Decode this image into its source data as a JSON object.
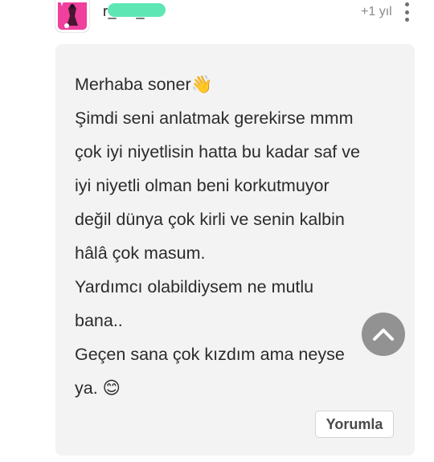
{
  "comment": {
    "username": "r_kie_",
    "time": "+1 yıl",
    "text": "Merhaba soner👋\nŞimdi seni anlatmak gerekirse mmm\nçok iyi niyetlisin hatta bu kadar saf ve\niyi niyetli olman beni korkutmuyor\ndeğil dünya çok kirli ve senin kalbin\nhâlâ çok masum.\nYardımcı olabildiysem ne mutlu\nbana..\nGeçen sana çok kızdım ama neyse\nya. 😊",
    "reply_label": "Yorumla"
  },
  "icons": {
    "avatar": "profile-avatar",
    "more": "kebab-menu-icon",
    "scroll_top": "chevron-up-icon"
  },
  "colors": {
    "avatar_bg": "#f03f9c",
    "redaction": "#5ee7b4",
    "card_bg": "#f3f3f3",
    "scroll_button": "#848484"
  }
}
